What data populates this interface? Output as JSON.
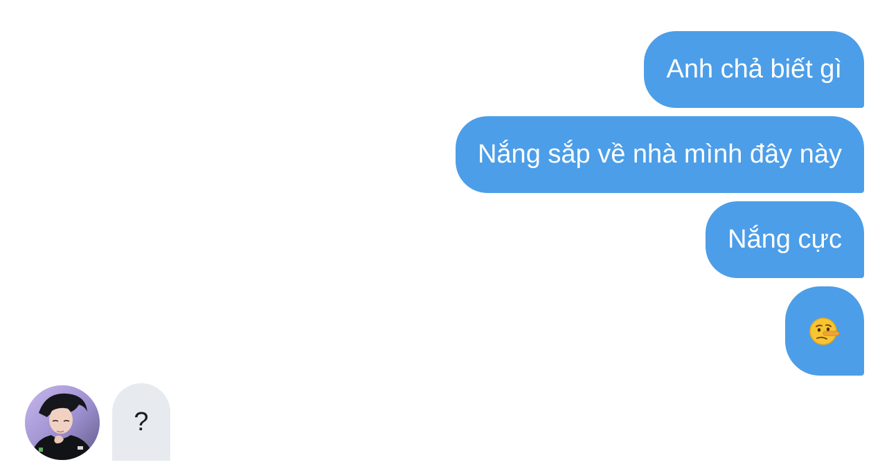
{
  "conversation": {
    "sent_messages": [
      "Anh chả biết gì",
      "Nắng sắp về nhà mình đây này",
      "Nắng cực"
    ],
    "sent_emoji": "lying-face-emoji",
    "received_message": "?",
    "contact_avatar": "contact-avatar-photo"
  },
  "colors": {
    "sent_bubble": "#4c9ee8",
    "received_bubble": "#e7ebef",
    "sent_text": "#ffffff",
    "received_text": "#1a1d21"
  }
}
